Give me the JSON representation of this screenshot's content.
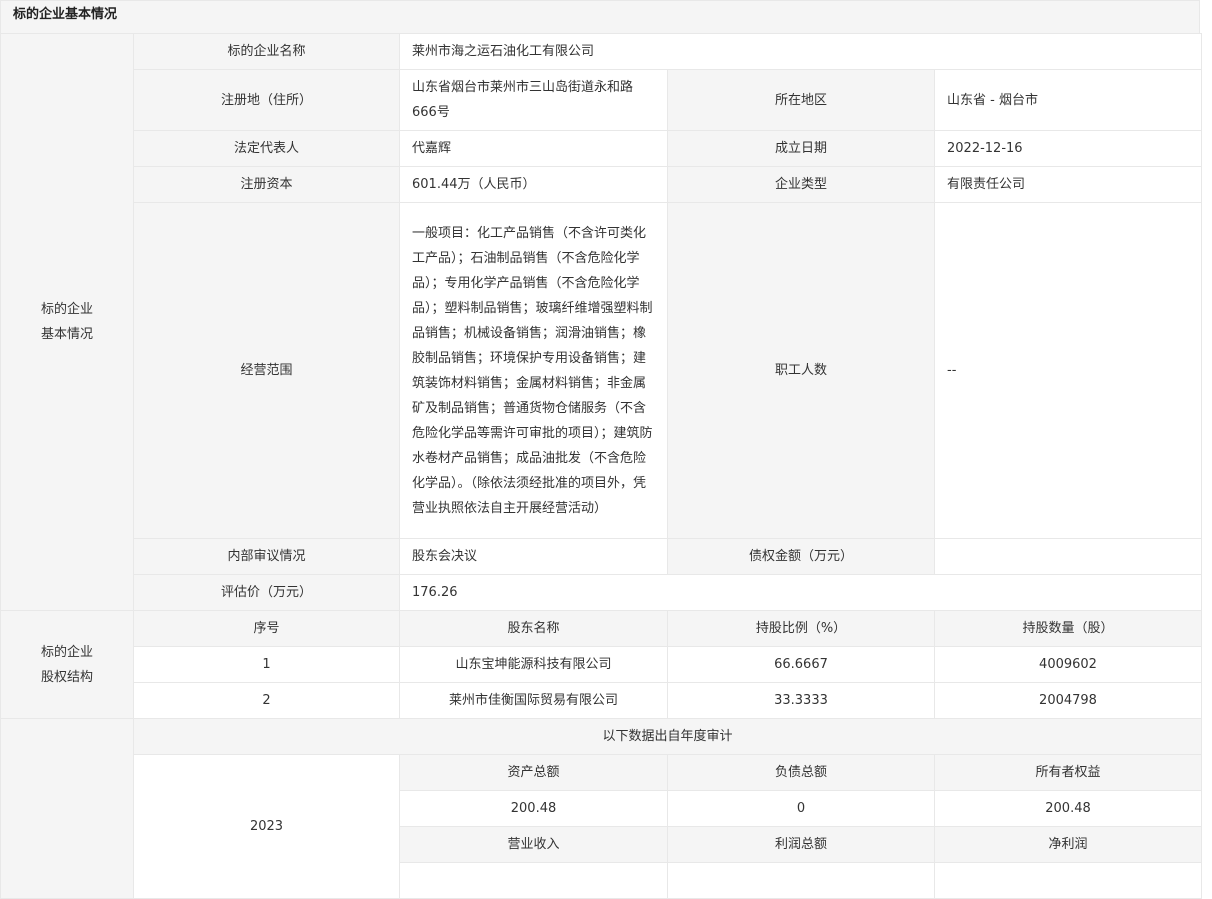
{
  "header": {
    "title": "标的企业基本情况"
  },
  "basic": {
    "section_label": "标的企业\n基本情况",
    "name_label": "标的企业名称",
    "name_value": "莱州市海之运石油化工有限公司",
    "address_label": "注册地（住所）",
    "address_value": "山东省烟台市莱州市三山岛街道永和路666号",
    "region_label": "所在地区",
    "region_value": "山东省 - 烟台市",
    "legal_rep_label": "法定代表人",
    "legal_rep_value": "代嘉辉",
    "founded_label": "成立日期",
    "founded_value": "2022-12-16",
    "capital_label": "注册资本",
    "capital_value": "601.44万（人民币）",
    "type_label": "企业类型",
    "type_value": "有限责任公司",
    "scope_label": "经营范围",
    "scope_value": "一般项目：化工产品销售（不含许可类化工产品）；石油制品销售（不含危险化学品）；专用化学产品销售（不含危险化学品）；塑料制品销售；玻璃纤维增强塑料制品销售；机械设备销售；润滑油销售；橡胶制品销售；环境保护专用设备销售；建筑装饰材料销售；金属材料销售；非金属矿及制品销售；普通货物仓储服务（不含危险化学品等需许可审批的项目）；建筑防水卷材产品销售；成品油批发（不含危险化学品）。（除依法须经批准的项目外，凭营业执照依法自主开展经营活动）",
    "employees_label": "职工人数",
    "employees_value": "--",
    "audit_label": "内部审议情况",
    "audit_value": "股东会决议",
    "debt_label": "债权金额（万元）",
    "debt_value": "",
    "valuation_label": "评估价（万元）",
    "valuation_value": "176.26"
  },
  "equity": {
    "section_label": "标的企业\n股权结构",
    "columns": [
      "序号",
      "股东名称",
      "持股比例（%）",
      "持股数量（股）"
    ],
    "rows": [
      [
        "1",
        "山东宝坤能源科技有限公司",
        "66.6667",
        "4009602"
      ],
      [
        "2",
        "莱州市佳衡国际贸易有限公司",
        "33.3333",
        "2004798"
      ]
    ]
  },
  "financial": {
    "note": "以下数据出自年度审计",
    "year": "2023",
    "headers1": [
      "资产总额",
      "负债总额",
      "所有者权益"
    ],
    "values1": [
      "200.48",
      "0",
      "200.48"
    ],
    "headers2": [
      "营业收入",
      "利润总额",
      "净利润"
    ]
  }
}
